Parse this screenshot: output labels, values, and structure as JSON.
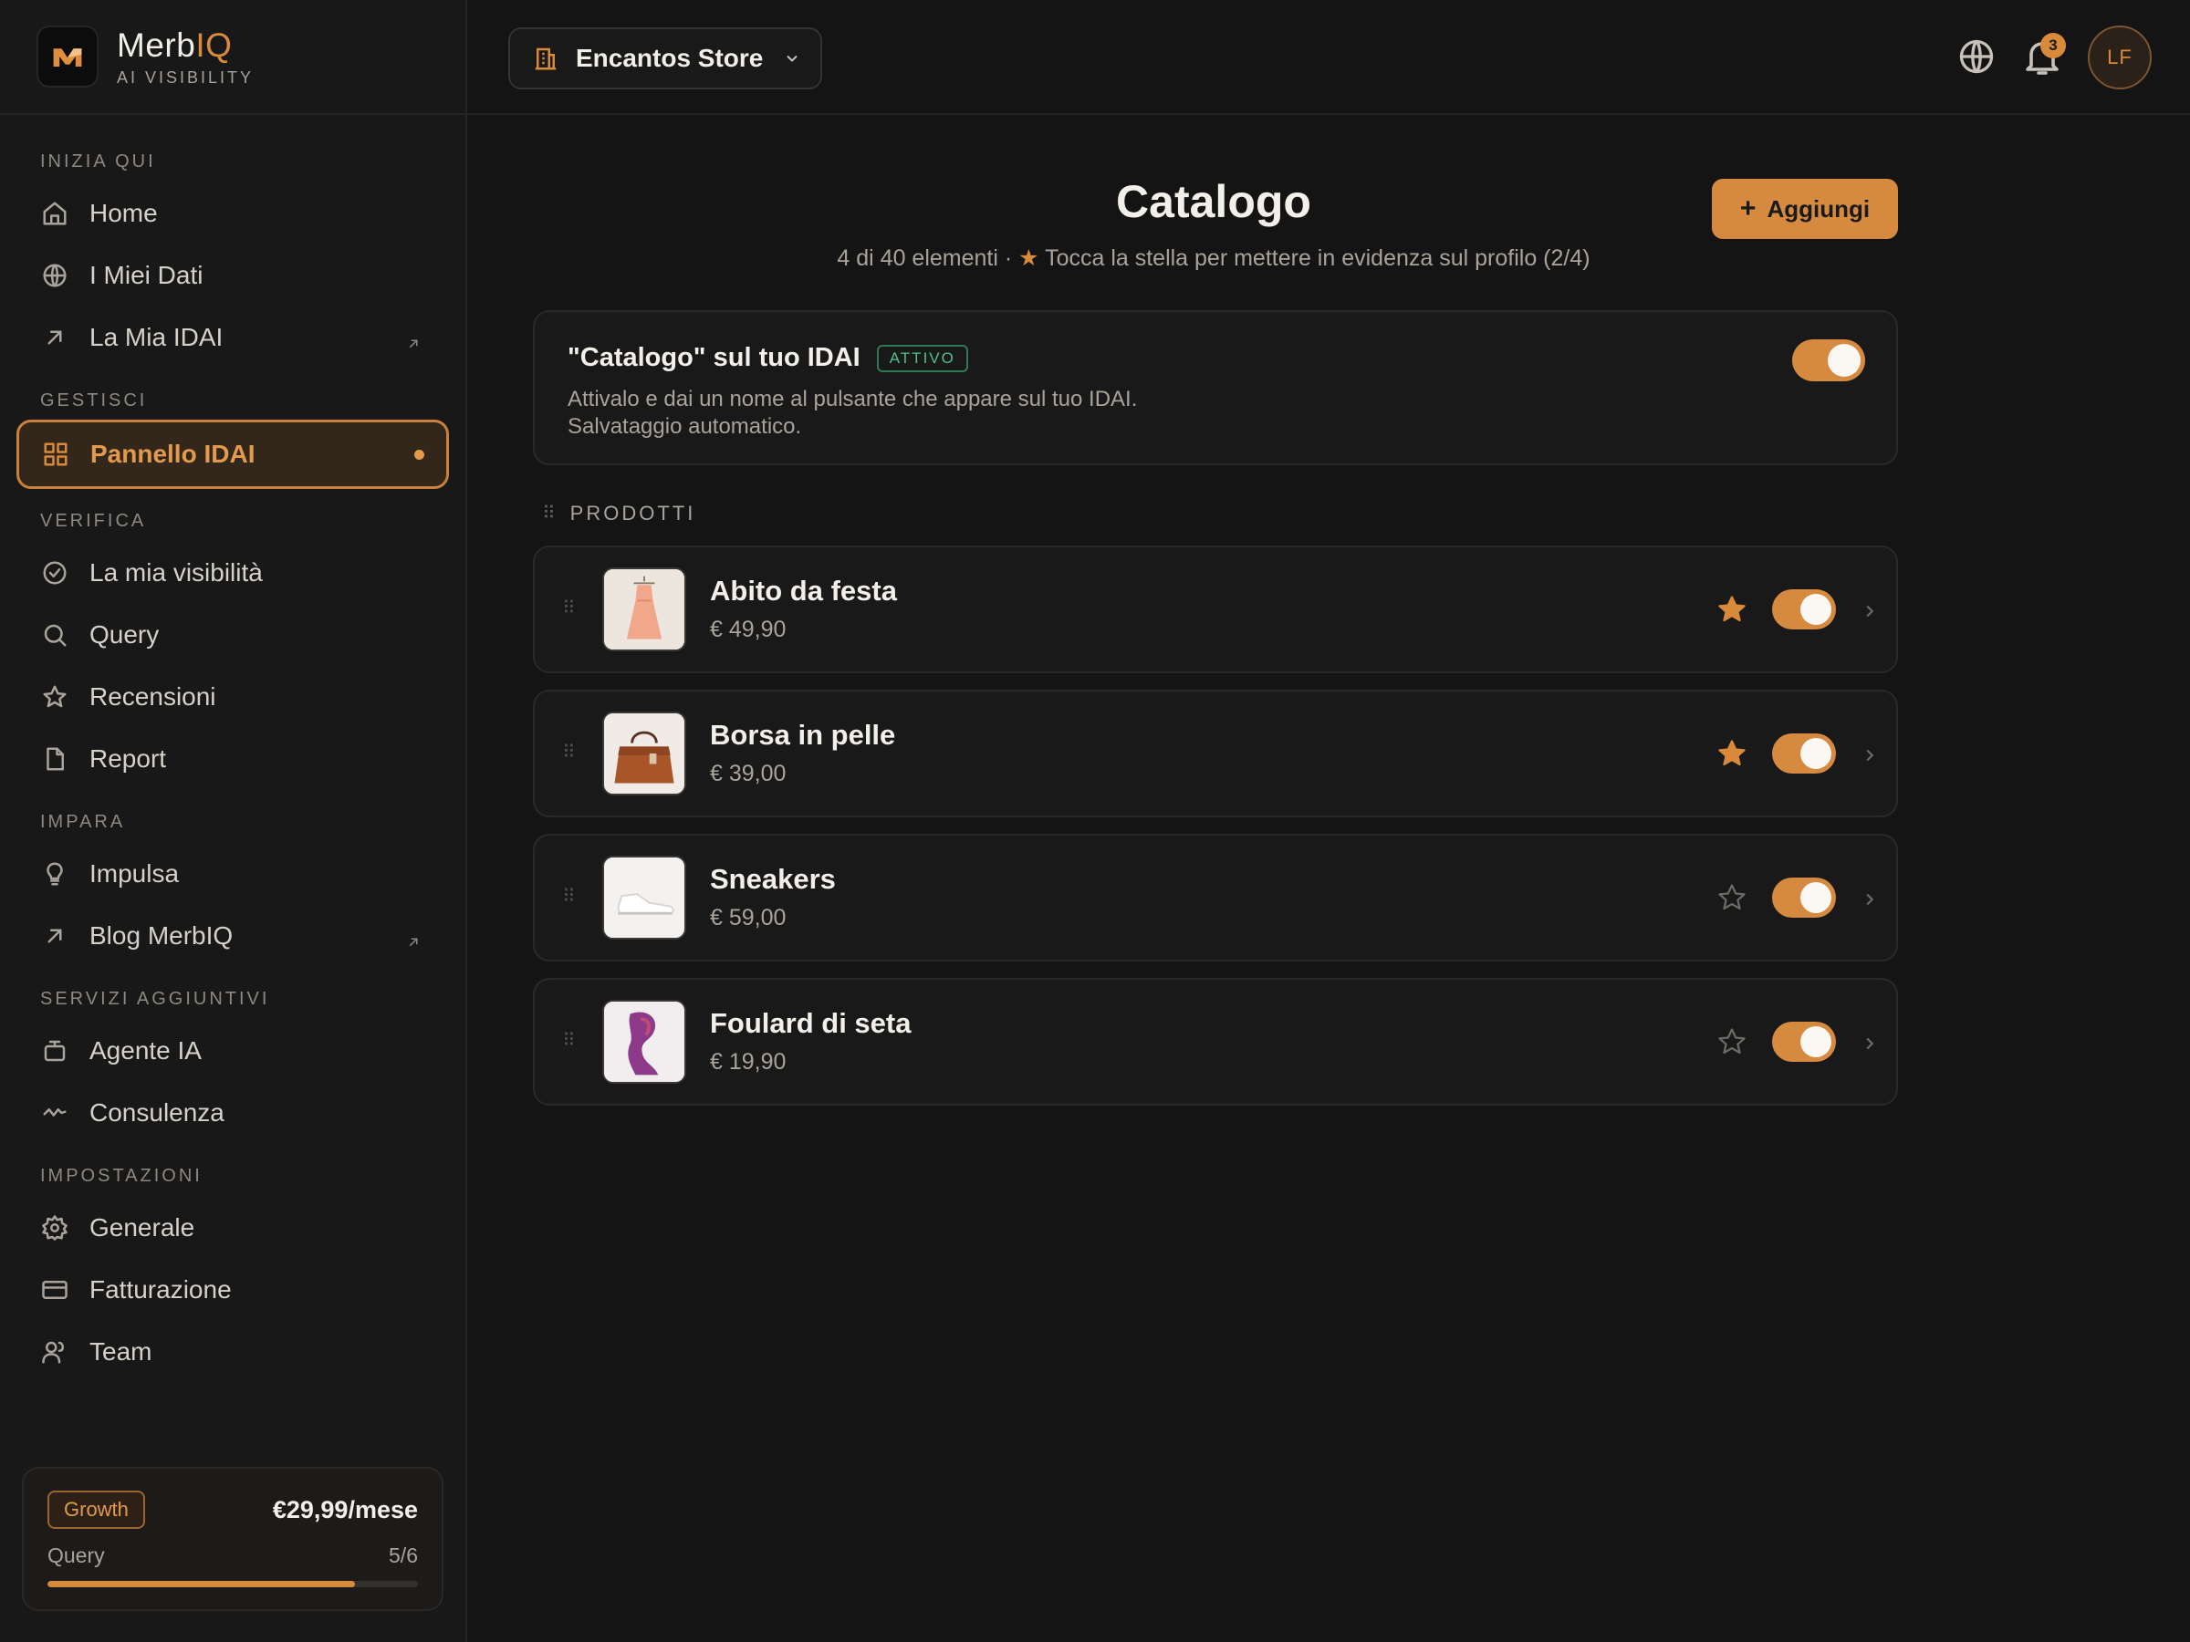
{
  "brand": {
    "name_main": "Merb",
    "name_accent": "IQ",
    "subtitle": "AI VISIBILITY"
  },
  "colors": {
    "accent": "#d58a3f",
    "background": "#141414",
    "sidebar": "#181818",
    "active_badge": "#4fc08a"
  },
  "sidebar": {
    "sections": [
      {
        "title": "INIZIA QUI",
        "items": [
          {
            "label": "Home",
            "icon": "home-icon"
          },
          {
            "label": "I Miei Dati",
            "icon": "globe-icon"
          },
          {
            "label": "La Mia IDAI",
            "icon": "arrow-up-right-icon",
            "external": true
          }
        ]
      },
      {
        "title": "GESTISCI",
        "items": [
          {
            "label": "Pannello IDAI",
            "icon": "grid-icon",
            "active": true
          }
        ]
      },
      {
        "title": "VERIFICA",
        "items": [
          {
            "label": "La mia visibilità",
            "icon": "check-circle-icon"
          },
          {
            "label": "Query",
            "icon": "search-icon"
          },
          {
            "label": "Recensioni",
            "icon": "star-icon"
          },
          {
            "label": "Report",
            "icon": "file-icon"
          }
        ]
      },
      {
        "title": "IMPARA",
        "items": [
          {
            "label": "Impulsa",
            "icon": "lightbulb-icon"
          },
          {
            "label": "Blog MerbIQ",
            "icon": "arrow-up-right-icon",
            "external": true
          }
        ]
      },
      {
        "title": "SERVIZI AGGIUNTIVI",
        "items": [
          {
            "label": "Agente IA",
            "icon": "bot-icon"
          },
          {
            "label": "Consulenza",
            "icon": "activity-icon"
          }
        ]
      },
      {
        "title": "IMPOSTAZIONI",
        "items": [
          {
            "label": "Generale",
            "icon": "gear-icon"
          },
          {
            "label": "Fatturazione",
            "icon": "credit-card-icon"
          },
          {
            "label": "Team",
            "icon": "users-icon"
          }
        ]
      }
    ],
    "plan": {
      "badge": "Growth",
      "price": "€29,99/mese",
      "usage_label": "Query",
      "usage_value": "5/6",
      "usage_fraction": 0.83
    }
  },
  "header": {
    "store_name": "Encantos Store",
    "notifications_count": "3",
    "avatar_initials": "LF"
  },
  "main": {
    "title": "Catalogo",
    "subtitle_count": "4 di 40 elementi ·",
    "subtitle_star": "★",
    "subtitle_hint": "Tocca la stella per mettere in evidenza sul profilo (2/4)",
    "add_button": {
      "icon": "+",
      "label": "Aggiungi"
    },
    "feature": {
      "title": "\"Catalogo\" sul tuo IDAI",
      "badge": "ATTIVO",
      "description_line1": "Attivalo e dai un nome al pulsante che appare sul tuo IDAI.",
      "description_line2": "Salvataggio automatico.",
      "enabled": true
    },
    "section_label": "PRODOTTI",
    "products": [
      {
        "name": "Abito da festa",
        "price": "€ 49,90",
        "featured": true,
        "enabled": true,
        "image": "dress-image"
      },
      {
        "name": "Borsa in pelle",
        "price": "€ 39,00",
        "featured": true,
        "enabled": true,
        "image": "bag-image"
      },
      {
        "name": "Sneakers",
        "price": "€ 59,00",
        "featured": false,
        "enabled": true,
        "image": "sneakers-image"
      },
      {
        "name": "Foulard di seta",
        "price": "€ 19,90",
        "featured": false,
        "enabled": true,
        "image": "scarf-image"
      }
    ]
  }
}
